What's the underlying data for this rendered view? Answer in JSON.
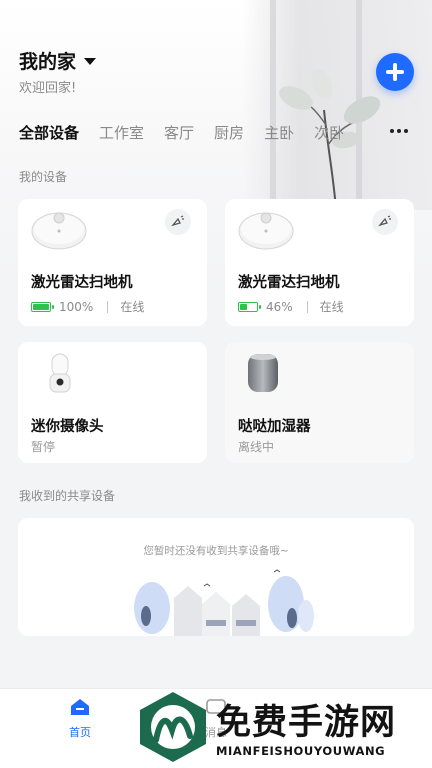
{
  "header": {
    "home_title": "我的家",
    "welcome": "欢迎回家!"
  },
  "tabs": [
    "全部设备",
    "工作室",
    "客厅",
    "厨房",
    "主卧",
    "次卧"
  ],
  "sections": {
    "my_devices": "我的设备",
    "shared_devices": "我收到的共享设备"
  },
  "devices": [
    {
      "name": "激光雷达扫地机",
      "battery": "100%",
      "battery_level": 1.0,
      "status": "在线",
      "icon": "robot-vacuum"
    },
    {
      "name": "激光雷达扫地机",
      "battery": "46%",
      "battery_level": 0.46,
      "status": "在线",
      "icon": "robot-vacuum"
    },
    {
      "name": "迷你摄像头",
      "status": "暂停",
      "icon": "mini-camera"
    },
    {
      "name": "哒哒加湿器",
      "status": "离线中",
      "icon": "humidifier"
    }
  ],
  "shared_empty": {
    "message": "您暂时还没有收到共享设备哦~"
  },
  "bottom_nav": {
    "home": "首页",
    "messages": "消息"
  },
  "watermark": {
    "title": "免费手游网",
    "subtitle": "MIANFEISHOUYOUWANG"
  },
  "colors": {
    "accent": "#1f6bff",
    "battery": "#2ec24a",
    "watermark_logo": "#1d6b4f"
  }
}
